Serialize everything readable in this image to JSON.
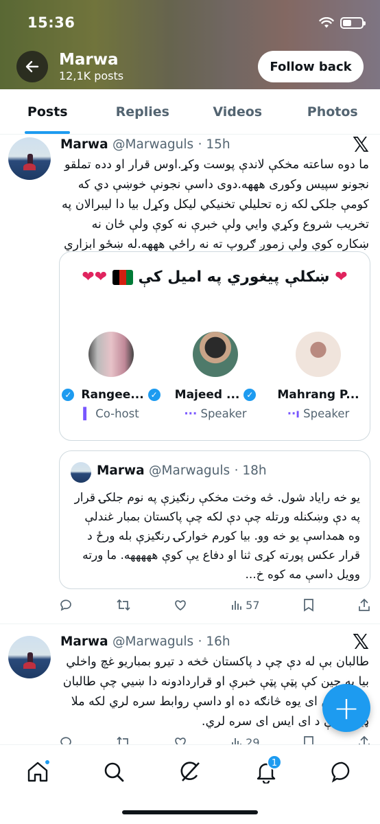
{
  "status_bar": {
    "time": "15:36"
  },
  "header": {
    "name": "Marwa",
    "post_count": "12,1K posts",
    "follow_label": "Follow back",
    "banner_color": "#7d8050"
  },
  "tabs": [
    {
      "label": "Posts",
      "active": true
    },
    {
      "label": "Replies",
      "active": false
    },
    {
      "label": "Videos",
      "active": false
    },
    {
      "label": "Photos",
      "active": false
    }
  ],
  "tweets": [
    {
      "name": "Marwa",
      "handle": "@Marwaguls",
      "time": "· 15h",
      "text": "ما دوه ساعته مخکې لاندې پوست وکړ.اوس قرار او دده تملقو نجونو سپیس وکوری هههه.دوی داسې نجونې خوښې دي که کومې جلکۍ لکه زه تحلیلي تخنیکي لیکل وکړل بیا دا لیبرالان په تخریب شروع وکړي وایي ولې خبرې نه کوې ولې ځان نه ښکاره کوې ولې زموږ ګروپ ته نه راځې هههه.له ښځو ابزاري استفاده نه منم",
      "space": {
        "title": "ښکلې پیغوري په امیل کې",
        "title_full": "ښکلې پیغوري په امیل کې",
        "speakers": [
          {
            "name": "Rangee...",
            "role": "Co-host"
          },
          {
            "name": "Majeed ...",
            "role": "Speaker"
          },
          {
            "name": "Mahrang P...",
            "role": "Speaker"
          }
        ]
      },
      "quote": {
        "name": "Marwa",
        "handle": "@Marwaguls",
        "time": "· 18h",
        "text": "یو خه رایاد شول. څه وخت مخکې رنګیزې په نوم جلکۍ قرار په دې وښکنله ورتله چې دې لکه چې پاکستان بمبار غندلې وه همداسې یو خه وو. بیا کورم خوارکۍ رنګیزې بله ورځ د قرار عکس پورته کړی ثنا او دفاع یې کوې هههههه. ما ورته وویل داسې مه کوه خ..."
      },
      "actions": {
        "reply": "",
        "repost": "",
        "like": "",
        "views": "57"
      }
    },
    {
      "name": "Marwa",
      "handle": "@Marwaguls",
      "time": "· 16h",
      "text": "طالبان بې له دې چې د پاکستان څخه د تیرو بمباریو غچ واخلي بیا په چین کې پټې پټې خبرې او قراردادونه دا ښیي چې طالبان د ای ایس ای یوه څانګه ده او داسې روابط سره لري لکه ملا ډیزل چې د ای ایس ای سره لري.",
      "actions": {
        "views": "29"
      }
    }
  ],
  "fab_label": "+",
  "notifications_badge": "1",
  "accent_color": "#1d9bf0"
}
